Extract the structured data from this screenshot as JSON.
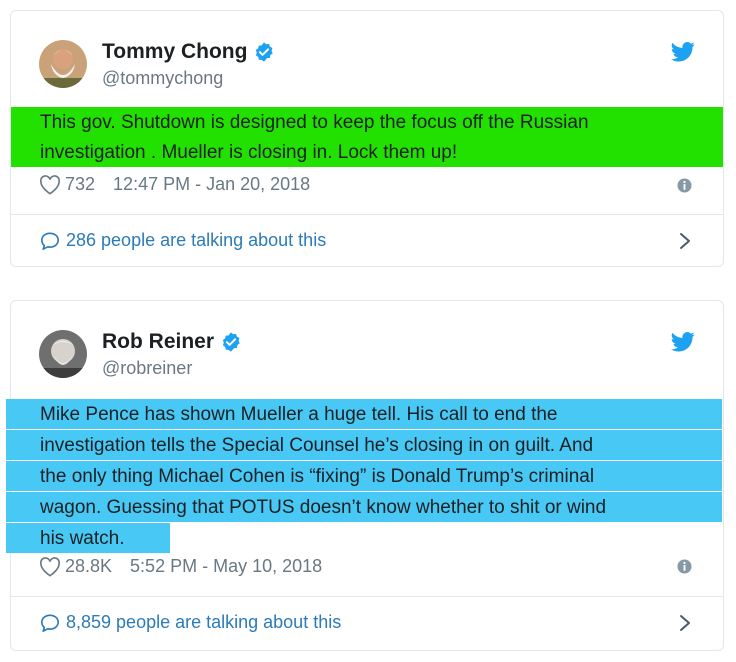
{
  "colors": {
    "highlight_green": "#22e000",
    "highlight_blue": "#47c8f5",
    "verified_blue": "#1da1f2",
    "link_blue": "#2b7bb9",
    "meta_gray": "#697882"
  },
  "tweets": [
    {
      "name": "Tommy Chong",
      "handle": "@tommychong",
      "text_lines": [
        "This gov. Shutdown is designed to keep the focus off the Russian",
        "investigation . Mueller is closing in. Lock them up!"
      ],
      "highlight": "green",
      "likes": "732",
      "timestamp": "12:47 PM - Jan 20, 2018",
      "talking": "286 people are talking about this",
      "icons": [
        "avatar",
        "verified-icon",
        "twitter-bird-icon",
        "heart-icon",
        "info-icon",
        "speech-bubble-icon",
        "chevron-right-icon"
      ]
    },
    {
      "name": "Rob Reiner",
      "handle": "@robreiner",
      "text_lines": [
        "Mike Pence has shown Mueller a huge tell. His call to end the",
        "investigation tells the Special Counsel he’s closing in on guilt. And",
        "the only thing Michael Cohen is “fixing” is Donald Trump’s criminal",
        "wagon. Guessing that POTUS doesn’t know whether to shit or wind",
        "his watch."
      ],
      "highlight": "blue",
      "likes": "28.8K",
      "timestamp": "5:52 PM - May 10, 2018",
      "talking": "8,859 people are talking about this",
      "icons": [
        "avatar",
        "verified-icon",
        "twitter-bird-icon",
        "heart-icon",
        "info-icon",
        "speech-bubble-icon",
        "chevron-right-icon"
      ]
    }
  ]
}
